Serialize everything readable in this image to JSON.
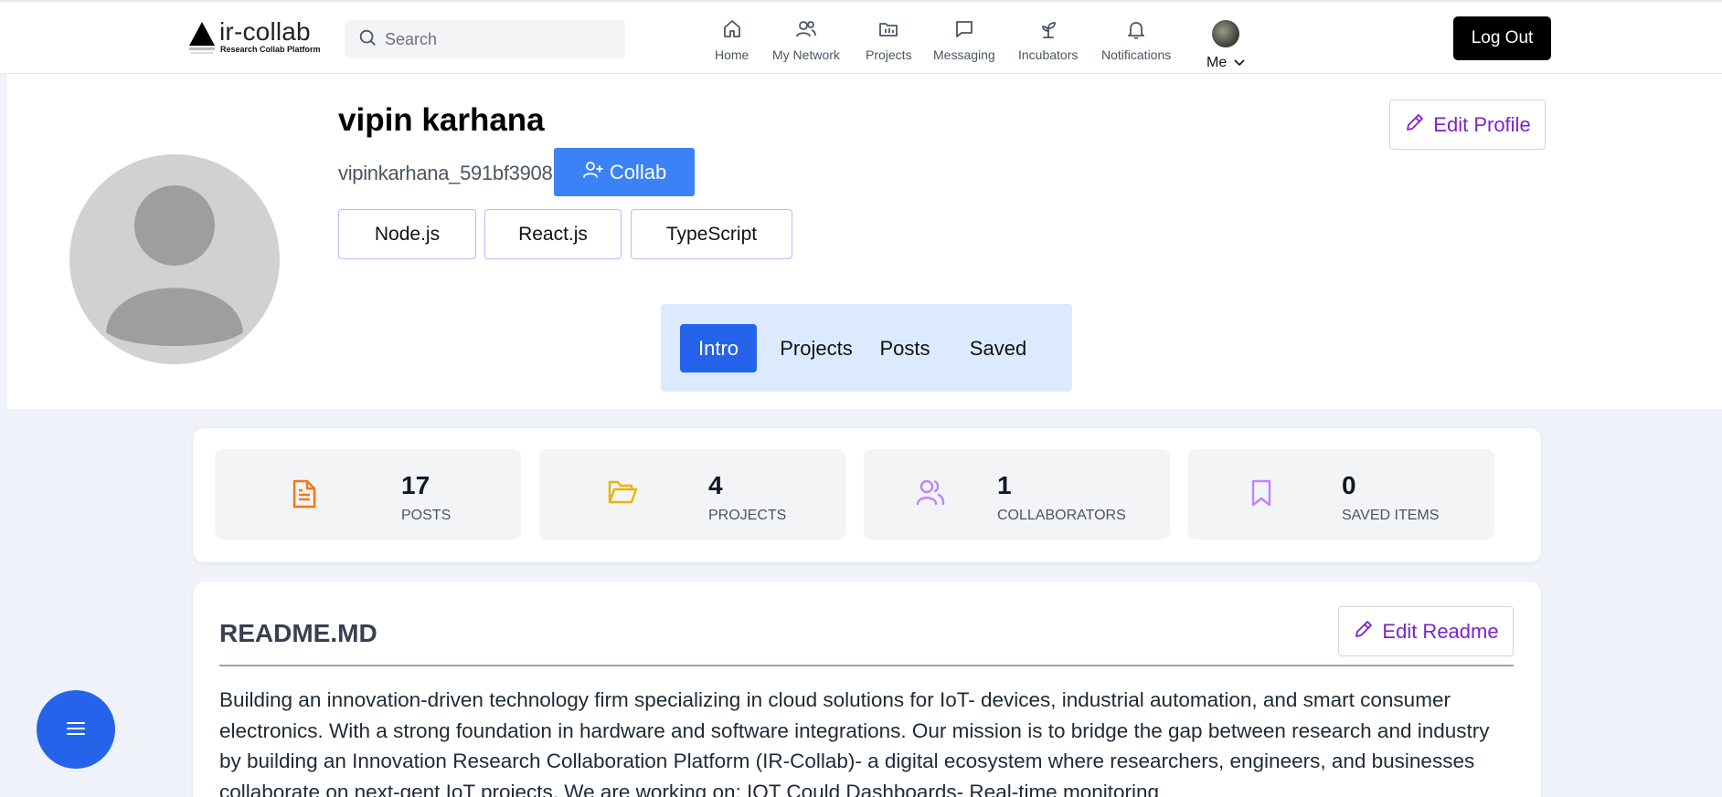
{
  "brand": {
    "name": "ir-collab",
    "tagline": "Research Collab Platform"
  },
  "search": {
    "placeholder": "Search"
  },
  "nav": {
    "home": "Home",
    "network": "My Network",
    "projects": "Projects",
    "messaging": "Messaging",
    "incubators": "Incubators",
    "notifications": "Notifications",
    "me": "Me",
    "logout": "Log Out"
  },
  "profile": {
    "name": "vipin karhana",
    "username": "vipinkarhana_591bf3908",
    "collab_label": "Collab",
    "edit_label": "Edit Profile",
    "skills": [
      "Node.js",
      "React.js",
      "TypeScript"
    ]
  },
  "tabs": {
    "intro": "Intro",
    "projects": "Projects",
    "posts": "Posts",
    "saved": "Saved",
    "active": "Intro"
  },
  "stats": [
    {
      "value": "17",
      "label": "POSTS",
      "icon": "document-icon",
      "color": "#f97316"
    },
    {
      "value": "4",
      "label": "PROJECTS",
      "icon": "folder-open-icon",
      "color": "#eab308"
    },
    {
      "value": "1",
      "label": "COLLABORATORS",
      "icon": "users-icon",
      "color": "#c084fc"
    },
    {
      "value": "0",
      "label": "SAVED ITEMS",
      "icon": "bookmark-icon",
      "color": "#c084fc"
    }
  ],
  "readme": {
    "title": "README.MD",
    "edit_label": "Edit Readme",
    "body": "Building an innovation-driven technology firm specializing in cloud solutions for IoT- devices, industrial automation, and smart consumer electronics. With a strong foundation in hardware and software integrations. Our mission is to bridge the gap between research and industry by building an Innovation Research Collaboration Platform (IR-Collab)- a digital ecosystem where researchers, engineers, and businesses collaborate on next-gent IoT projects. We are working on: IOT Could Dashboards- Real-time monitoring"
  },
  "colors": {
    "primary": "#2563eb",
    "collab": "#3b82f6",
    "edit": "#7e22ce",
    "tabs_bg": "#dbeafe"
  }
}
